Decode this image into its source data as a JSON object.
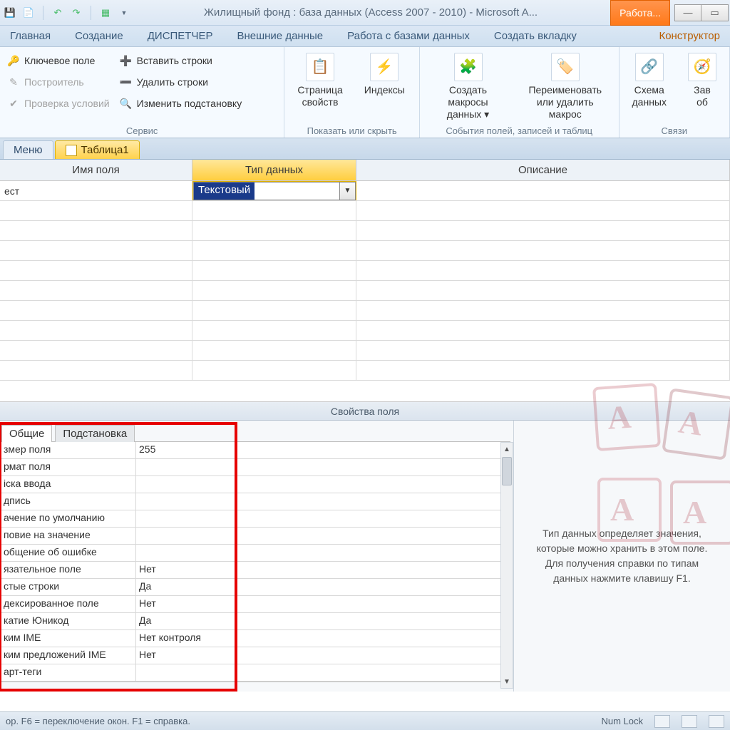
{
  "title": "Жилищный фонд : база данных (Access 2007 - 2010)  -  Microsoft A...",
  "context_chip": "Работа...",
  "win_min": "—",
  "win_max": "▭",
  "ribbon_tabs": {
    "home": "Главная",
    "create": "Создание",
    "dispatcher": "ДИСПЕТЧЕР",
    "external": "Внешние данные",
    "dbtools": "Работа с базами данных",
    "createtab": "Создать вкладку",
    "constructor": "Конструктор"
  },
  "ribbon": {
    "group_service": "Сервис",
    "group_showhide": "Показать или скрыть",
    "group_events": "События полей, записей и таблиц",
    "group_links": "Связи",
    "key_field": "Ключевое поле",
    "builder": "Построитель",
    "check_rules": "Проверка условий",
    "insert_rows": "Вставить строки",
    "delete_rows": "Удалить строки",
    "modify_lookup": "Изменить подстановку",
    "prop_sheet_l1": "Страница",
    "prop_sheet_l2": "свойств",
    "indexes": "Индексы",
    "create_macros_l1": "Создать макросы",
    "create_macros_l2": "данных ▾",
    "rename_macro_l1": "Переименовать",
    "rename_macro_l2": "или удалить макрос",
    "schema_l1": "Схема",
    "schema_l2": "данных",
    "deps_l1": "Зав",
    "deps_l2": "об"
  },
  "doc_tabs": {
    "menu": "Меню",
    "table1": "Таблица1"
  },
  "design_headers": {
    "field_name": "Имя поля",
    "data_type": "Тип данных",
    "description": "Описание"
  },
  "row0_name": "ест",
  "row0_type": "Текстовый",
  "splitter_label": "Свойства поля",
  "prop_tabs": {
    "general": "Общие",
    "lookup": "Подстановка"
  },
  "props": [
    {
      "label": "змер поля",
      "value": "255"
    },
    {
      "label": "рмат поля",
      "value": ""
    },
    {
      "label": "іска ввода",
      "value": ""
    },
    {
      "label": "дпись",
      "value": ""
    },
    {
      "label": "ачение по умолчанию",
      "value": ""
    },
    {
      "label": "повие на значение",
      "value": ""
    },
    {
      "label": "общение об ошибке",
      "value": ""
    },
    {
      "label": "язательное поле",
      "value": "Нет"
    },
    {
      "label": "стые строки",
      "value": "Да"
    },
    {
      "label": "дексированное поле",
      "value": "Нет"
    },
    {
      "label": "катие Юникод",
      "value": "Да"
    },
    {
      "label": "ким IME",
      "value": "Нет контроля"
    },
    {
      "label": "ким предложений IME",
      "value": "Нет"
    },
    {
      "label": "арт-теги",
      "value": ""
    }
  ],
  "help_text": "Тип данных определяет значения, которые можно хранить в этом поле. Для получения справки по типам данных нажмите клавишу F1.",
  "status_left": "ор.  F6 = переключение окон.  F1 = справка.",
  "status_numlock": "Num Lock",
  "wm_letter": "A"
}
